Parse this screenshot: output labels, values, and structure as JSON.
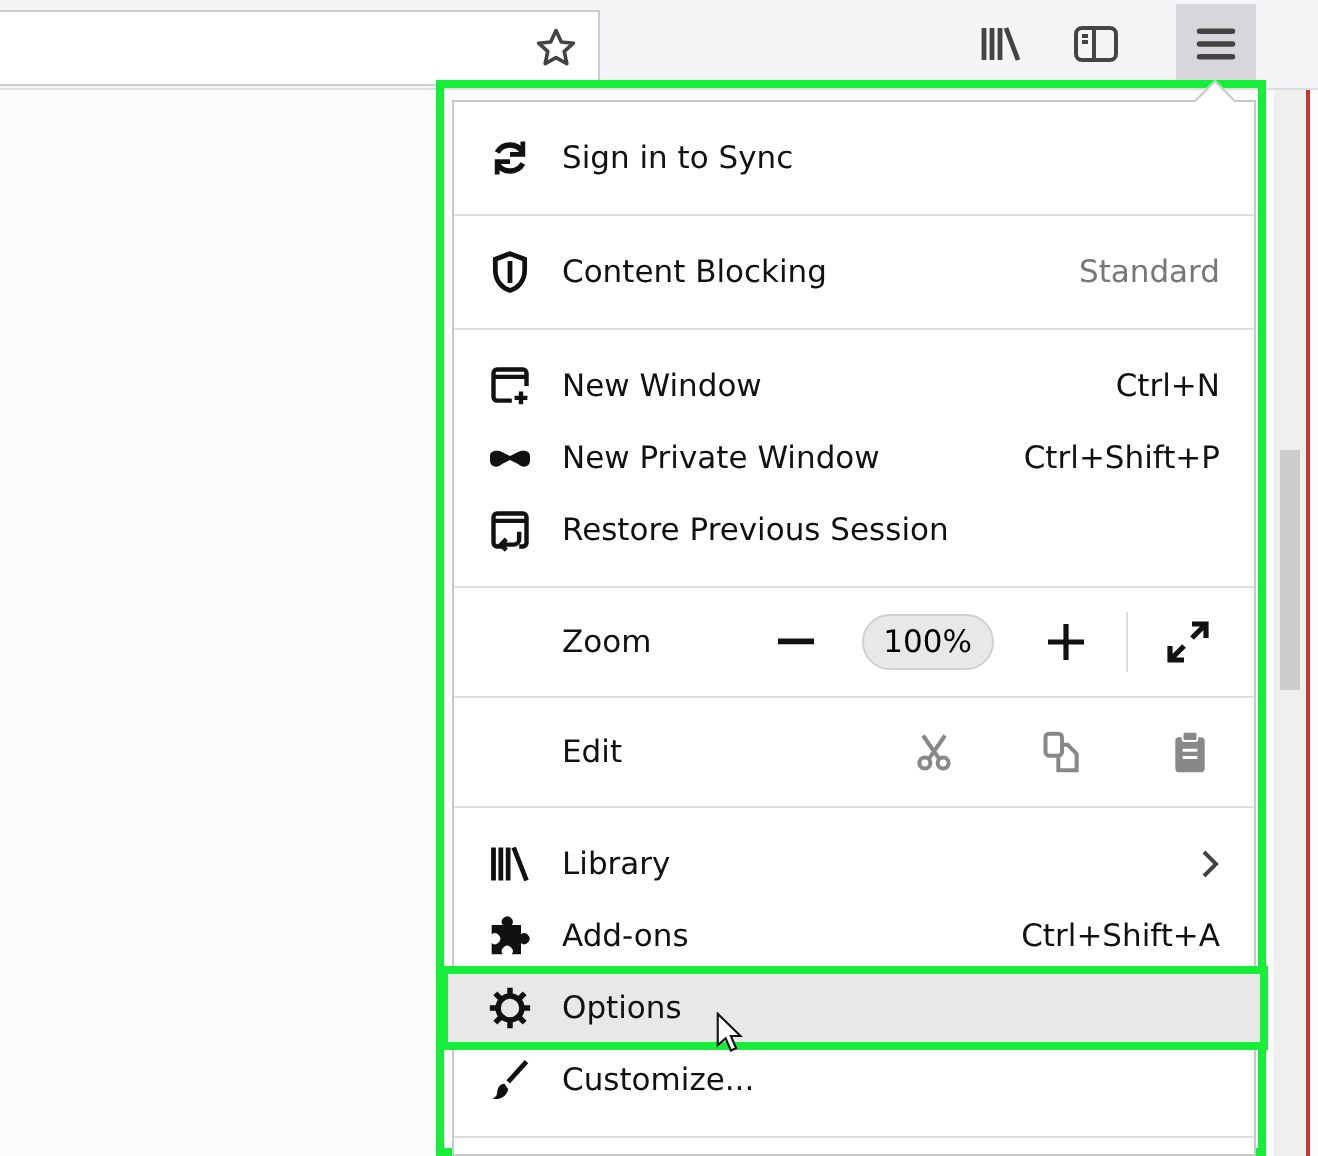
{
  "menu": {
    "sections": [
      {
        "items": [
          {
            "kind": "item",
            "label": "Sign in to Sync",
            "selected": false
          }
        ]
      },
      {
        "items": [
          {
            "kind": "item",
            "label": "Content Blocking",
            "detail": "Standard",
            "selected": false
          }
        ]
      },
      {
        "items": [
          {
            "kind": "item",
            "label": "New Window",
            "shortcut": "Ctrl+N",
            "selected": false
          },
          {
            "kind": "item",
            "label": "New Private Window",
            "shortcut": "Ctrl+Shift+P",
            "selected": false
          },
          {
            "kind": "item",
            "label": "Restore Previous Session",
            "selected": false
          }
        ]
      },
      {
        "items": [
          {
            "kind": "zoom",
            "label": "Zoom",
            "value": "100%"
          }
        ]
      },
      {
        "items": [
          {
            "kind": "edit",
            "label": "Edit"
          }
        ]
      },
      {
        "items": [
          {
            "kind": "item",
            "label": "Library",
            "submenu": true,
            "selected": false
          },
          {
            "kind": "item",
            "label": "Add-ons",
            "shortcut": "Ctrl+Shift+A",
            "selected": false
          },
          {
            "kind": "item",
            "label": "Options",
            "selected": true
          },
          {
            "kind": "item",
            "label": "Customize...",
            "selected": false
          }
        ]
      }
    ]
  }
}
